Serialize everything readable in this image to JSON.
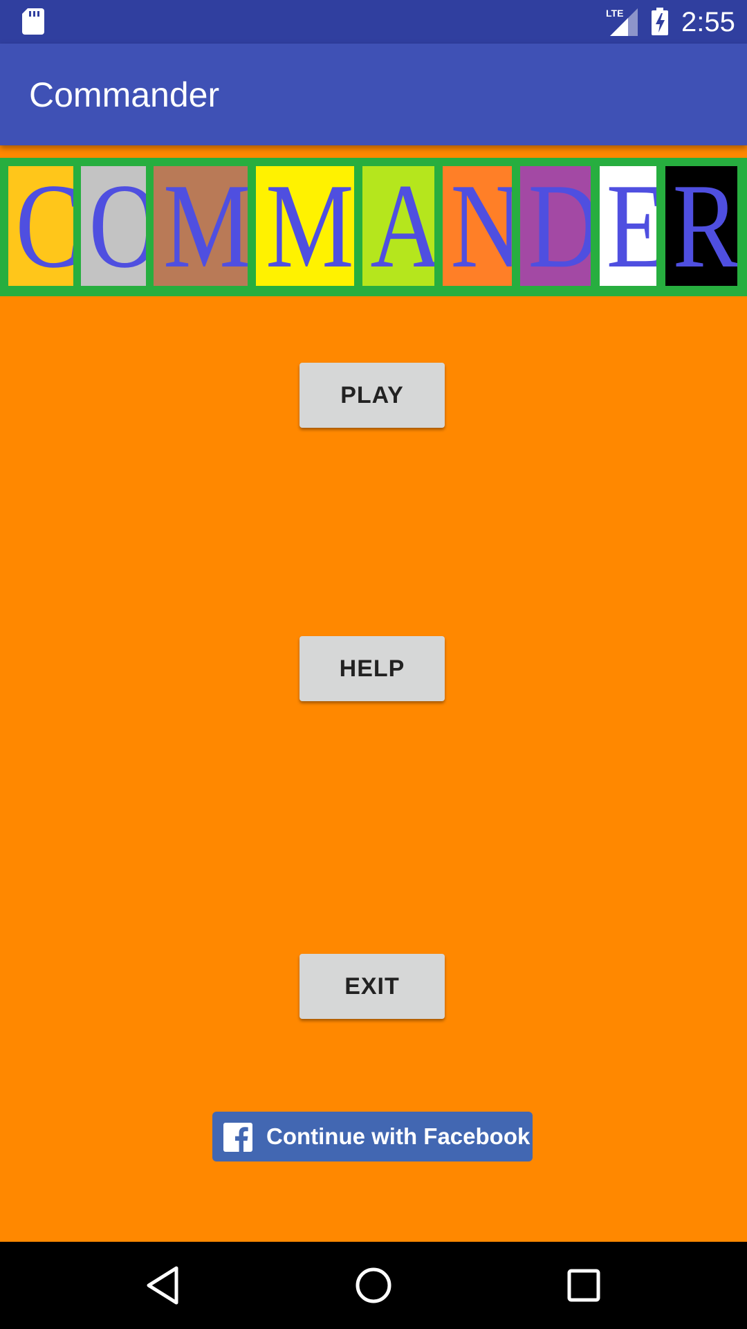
{
  "status_bar": {
    "time": "2:55",
    "network_label": "LTE",
    "icons": [
      "sd-card-icon",
      "lte-signal-icon",
      "battery-charging-icon"
    ]
  },
  "app_bar": {
    "title": "Commander",
    "color": "#3f51b5"
  },
  "banner": {
    "background": "#27ae3f",
    "letter_color": "#4f4fe0",
    "tiles": [
      {
        "letter": "C",
        "bg": "#ffc61a"
      },
      {
        "letter": "O",
        "bg": "#c3c3c3"
      },
      {
        "letter": "M",
        "bg": "#b97a57"
      },
      {
        "letter": "M",
        "bg": "#fff200"
      },
      {
        "letter": "A",
        "bg": "#b5e61d"
      },
      {
        "letter": "N",
        "bg": "#ff7f27"
      },
      {
        "letter": "D",
        "bg": "#a349a4"
      },
      {
        "letter": "E",
        "bg": "#ffffff"
      },
      {
        "letter": "R",
        "bg": "#000000"
      }
    ]
  },
  "menu": {
    "play_label": "PLAY",
    "help_label": "HELP",
    "exit_label": "EXIT"
  },
  "facebook": {
    "label": "Continue with Facebook",
    "icon": "facebook-icon",
    "color": "#4267b2"
  },
  "nav_bar": {
    "icons": [
      "back-icon",
      "home-icon",
      "recents-icon"
    ]
  },
  "colors": {
    "background": "#ff8800",
    "status_bar": "#303f9f",
    "button": "#d6d7d7"
  }
}
